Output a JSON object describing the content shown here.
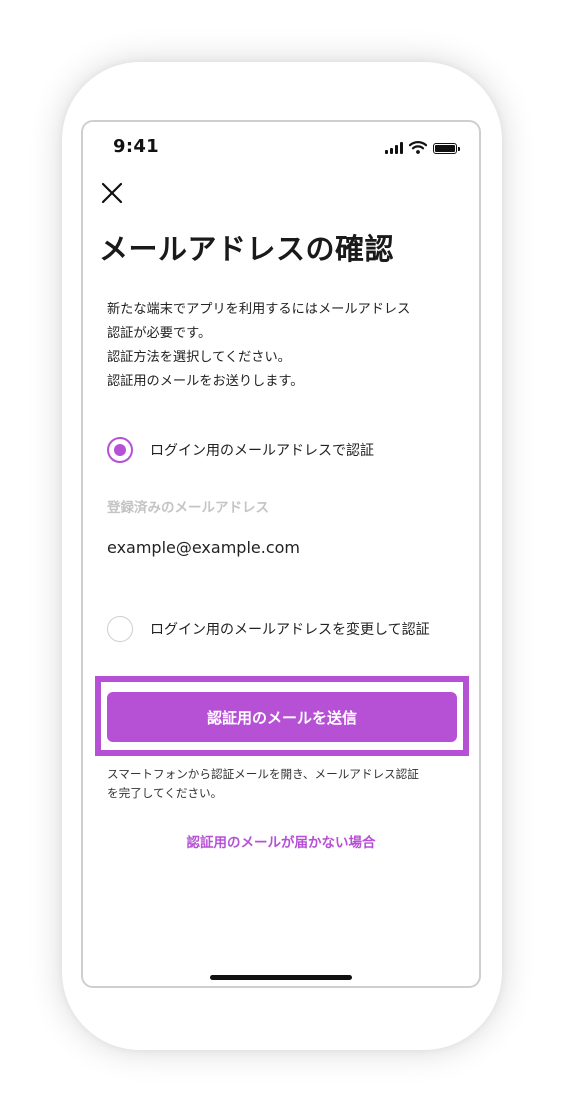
{
  "status_bar": {
    "time": "9:41",
    "icons": [
      "signal-icon",
      "wifi-icon",
      "battery-icon"
    ]
  },
  "header": {
    "close_icon": "close-icon",
    "title": "メールアドレスの確認"
  },
  "description": {
    "lines": [
      "新たな端末でアプリを利用するにはメールアドレス",
      "認証が必要です。",
      "認証方法を選択してください。",
      "認証用のメールをお送りします。"
    ]
  },
  "options": [
    {
      "label": "ログイン用のメールアドレスで認証",
      "selected": true
    },
    {
      "label": "ログイン用のメールアドレスを変更して認証",
      "selected": false
    }
  ],
  "registered_email": {
    "label": "登録済みのメールアドレス",
    "value": "example@example.com"
  },
  "send_button": {
    "label": "認証用のメールを送信"
  },
  "note": {
    "lines": [
      "スマートフォンから認証メールを開き、メールアドレス認証",
      "を完了してください。"
    ]
  },
  "help_link": {
    "label": "認証用のメールが届かない場合"
  },
  "colors": {
    "accent": "#b651d6",
    "text": "#222222",
    "muted": "#c4c4c4"
  }
}
